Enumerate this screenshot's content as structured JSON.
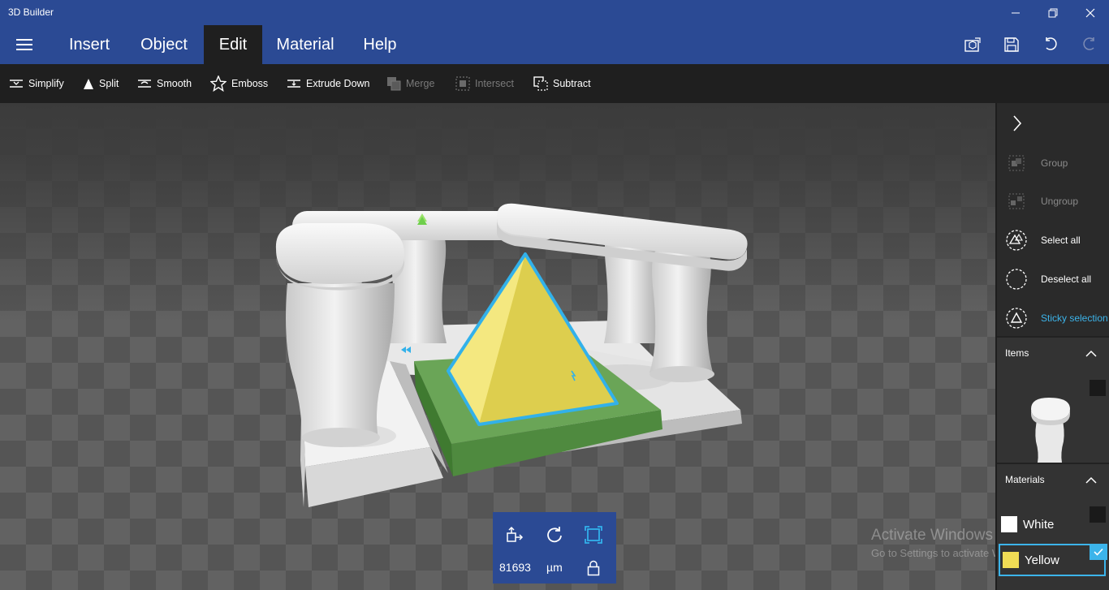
{
  "app": {
    "title": "3D Builder"
  },
  "window_controls": {
    "minimize": "minimize-icon",
    "maximize": "restore-icon",
    "close": "close-icon"
  },
  "menu": {
    "items": [
      {
        "label": "Insert",
        "active": false
      },
      {
        "label": "Object",
        "active": false
      },
      {
        "label": "Edit",
        "active": true
      },
      {
        "label": "Material",
        "active": false
      },
      {
        "label": "Help",
        "active": false
      }
    ],
    "right_icons": [
      "view-cube-icon",
      "save-icon",
      "undo-icon",
      "redo-icon"
    ]
  },
  "toolbar": {
    "tools": [
      {
        "label": "Simplify",
        "icon": "simplify-icon",
        "enabled": true
      },
      {
        "label": "Split",
        "icon": "split-icon",
        "enabled": true
      },
      {
        "label": "Smooth",
        "icon": "smooth-icon",
        "enabled": true
      },
      {
        "label": "Emboss",
        "icon": "star-icon",
        "enabled": true
      },
      {
        "label": "Extrude Down",
        "icon": "extrude-down-icon",
        "enabled": true
      },
      {
        "label": "Merge",
        "icon": "merge-icon",
        "enabled": false
      },
      {
        "label": "Intersect",
        "icon": "intersect-icon",
        "enabled": false
      },
      {
        "label": "Subtract",
        "icon": "subtract-icon",
        "enabled": true
      }
    ]
  },
  "transform": {
    "value": "81693",
    "unit": "µm",
    "icons": [
      "move-icon",
      "rotate-icon",
      "scale-icon",
      "lock-icon"
    ]
  },
  "watermark": {
    "title": "Activate Windows",
    "subtitle": "Go to Settings to activate Windows."
  },
  "side_panel": {
    "actions": [
      {
        "label": "Group",
        "enabled": false
      },
      {
        "label": "Ungroup",
        "enabled": false
      },
      {
        "label": "Select all",
        "enabled": true
      },
      {
        "label": "Deselect all",
        "enabled": true
      },
      {
        "label": "Sticky selection",
        "enabled": true,
        "active": true
      }
    ],
    "items_title": "Items",
    "materials_title": "Materials",
    "materials": [
      {
        "label": "White",
        "color": "#ffffff",
        "selected": false
      },
      {
        "label": "Yellow",
        "color": "#f0dc55",
        "selected": true
      }
    ]
  },
  "colors": {
    "title_bar": "#2b4a94",
    "toolbar": "#1f1f1f",
    "accent": "#3cb4ea",
    "pyramid": "#eede62",
    "base_green": "#5f9c4f"
  }
}
